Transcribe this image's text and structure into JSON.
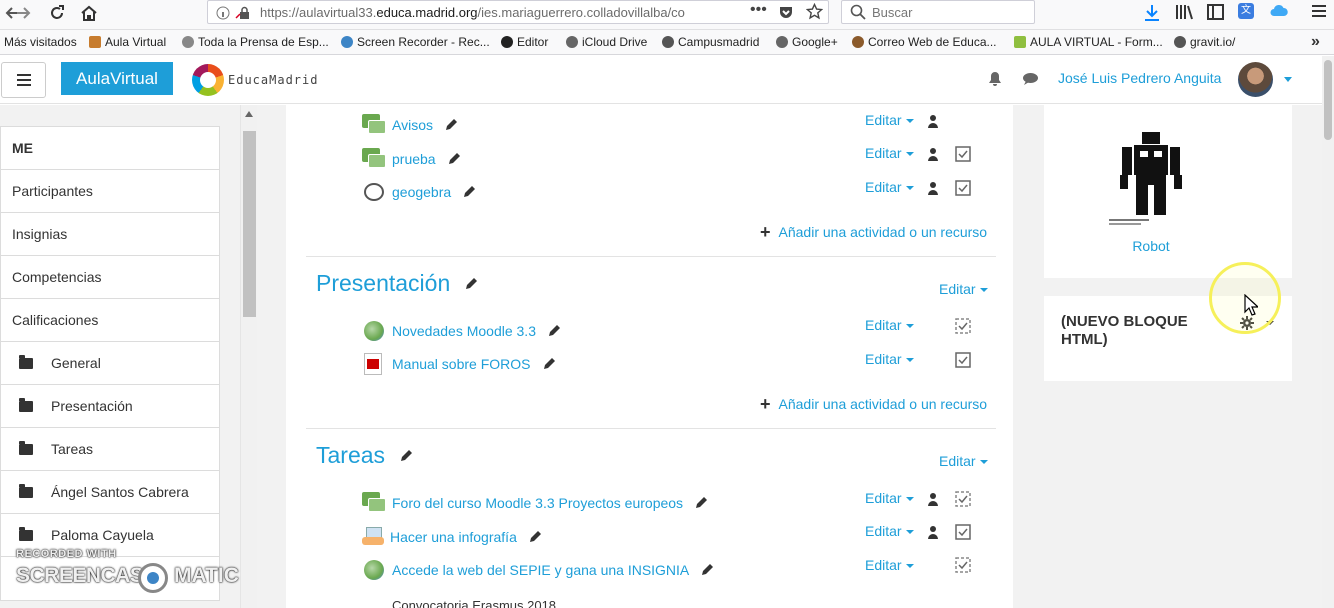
{
  "browser": {
    "url_prefix": "https://aulavirtual33.",
    "url_domain": "educa.madrid.org",
    "url_rest": "/ies.mariaguerrero.colladovillalba/co",
    "search_placeholder": "Buscar"
  },
  "bookmarks": [
    {
      "label": "Más visitados",
      "color": ""
    },
    {
      "label": "Aula Virtual",
      "color": "#c77c2e"
    },
    {
      "label": "Toda la Prensa de Esp...",
      "color": "#777777"
    },
    {
      "label": "Screen Recorder - Rec...",
      "color": "#3d85c6"
    },
    {
      "label": "Editor",
      "color": "#222222"
    },
    {
      "label": "iCloud Drive",
      "color": "#666666"
    },
    {
      "label": "Campusmadrid",
      "color": "#555555"
    },
    {
      "label": "Google+",
      "color": "#666666"
    },
    {
      "label": "Correo Web de Educa...",
      "color": "#8b5a2b"
    },
    {
      "label": "AULA VIRTUAL - Form...",
      "color": "#8fbf3f"
    },
    {
      "label": "gravit.io/",
      "color": "#555555"
    }
  ],
  "header": {
    "brand": "AulaVirtual",
    "logo_text": "EducaMadrid",
    "user_name": "José Luis Pedrero Anguita"
  },
  "nav": {
    "items": [
      {
        "label": "ME",
        "type": "head"
      },
      {
        "label": "Participantes",
        "type": "link"
      },
      {
        "label": "Insignias",
        "type": "link"
      },
      {
        "label": "Competencias",
        "type": "link"
      },
      {
        "label": "Calificaciones",
        "type": "link"
      },
      {
        "label": "General",
        "type": "section"
      },
      {
        "label": "Presentación",
        "type": "section"
      },
      {
        "label": "Tareas",
        "type": "section"
      },
      {
        "label": "Ángel Santos Cabrera",
        "type": "section"
      },
      {
        "label": "Paloma Cayuela",
        "type": "section"
      }
    ]
  },
  "course": {
    "edit_label": "Editar",
    "add_activity_label": "Añadir una actividad o un recurso",
    "general_activities": [
      {
        "name": "Avisos",
        "icon": "forum-icon"
      },
      {
        "name": "prueba",
        "icon": "forum-icon"
      },
      {
        "name": "geogebra",
        "icon": "geogebra-icon"
      }
    ],
    "presentacion": {
      "title": "Presentación",
      "activities": [
        {
          "name": "Novedades Moodle 3.3",
          "icon": "url-icon"
        },
        {
          "name": "Manual sobre FOROS",
          "icon": "pdf-icon"
        }
      ]
    },
    "tareas": {
      "title": "Tareas",
      "activities": [
        {
          "name": "Foro del curso Moodle 3.3 Proyectos europeos",
          "icon": "forum-icon"
        },
        {
          "name": "Hacer una infografía",
          "icon": "assignment-icon"
        },
        {
          "name": "Accede la web del SEPIE y gana una INSIGNIA",
          "icon": "url-icon"
        }
      ]
    },
    "cut_text": "Convocatoria Erasmus 2018"
  },
  "blocks": {
    "robot_label": "Robot",
    "html_block_title": "(NUEVO BLOQUE HTML)"
  },
  "watermark": {
    "line1": "RECORDED WITH",
    "line2": "SCREENCAST",
    "line3": "MATIC"
  },
  "colors": {
    "brand_blue": "#1e9ed8",
    "link_blue": "#1e9ed8",
    "cursor_ring": "#f6f05a"
  }
}
